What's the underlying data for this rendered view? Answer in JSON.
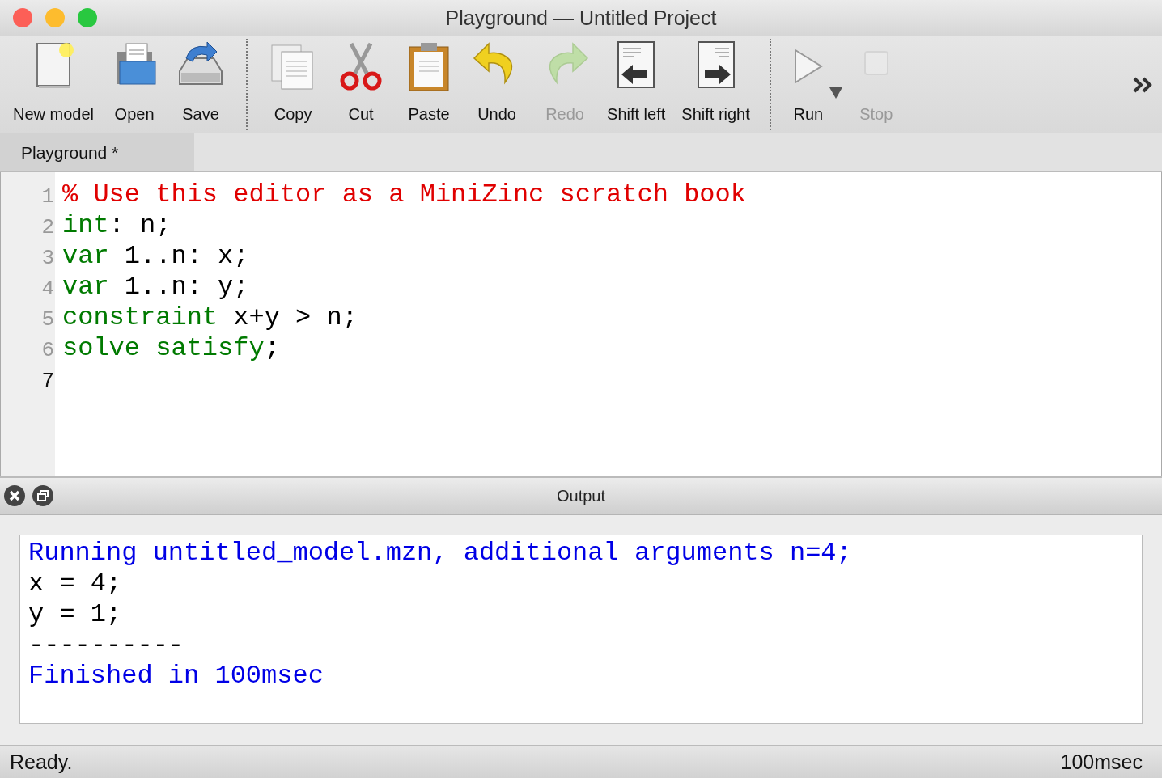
{
  "window": {
    "title": "Playground — Untitled Project"
  },
  "toolbar": {
    "groups": [
      {
        "items": [
          {
            "kind": "new",
            "label": "New model",
            "disabled": false
          },
          {
            "kind": "open",
            "label": "Open",
            "disabled": false
          },
          {
            "kind": "save",
            "label": "Save",
            "disabled": false
          }
        ]
      },
      {
        "items": [
          {
            "kind": "copy",
            "label": "Copy",
            "disabled": false
          },
          {
            "kind": "cut",
            "label": "Cut",
            "disabled": false
          },
          {
            "kind": "paste",
            "label": "Paste",
            "disabled": false
          },
          {
            "kind": "undo",
            "label": "Undo",
            "disabled": false
          },
          {
            "kind": "redo",
            "label": "Redo",
            "disabled": true
          },
          {
            "kind": "shift_left",
            "label": "Shift left",
            "disabled": false
          },
          {
            "kind": "shift_right",
            "label": "Shift right",
            "disabled": false
          }
        ]
      },
      {
        "items": [
          {
            "kind": "run",
            "label": "Run",
            "disabled": false
          },
          {
            "kind": "stop",
            "label": "Stop",
            "disabled": true
          }
        ]
      }
    ]
  },
  "tabs": [
    {
      "label": "Playground *",
      "selected": true
    }
  ],
  "editor": {
    "lines": [
      {
        "number": "1",
        "current": false,
        "tokens": [
          {
            "kind": "comment",
            "text": "% Use this editor as a MiniZinc scratch book"
          }
        ]
      },
      {
        "number": "2",
        "current": false,
        "tokens": [
          {
            "kind": "keyword",
            "text": "int"
          },
          {
            "kind": "plain",
            "text": ": n;"
          }
        ]
      },
      {
        "number": "3",
        "current": false,
        "tokens": [
          {
            "kind": "keyword",
            "text": "var"
          },
          {
            "kind": "plain",
            "text": " 1..n: x;"
          }
        ]
      },
      {
        "number": "4",
        "current": false,
        "tokens": [
          {
            "kind": "keyword",
            "text": "var"
          },
          {
            "kind": "plain",
            "text": " 1..n: y;"
          }
        ]
      },
      {
        "number": "5",
        "current": false,
        "tokens": [
          {
            "kind": "keyword",
            "text": "constraint"
          },
          {
            "kind": "plain",
            "text": " x+y > n;"
          }
        ]
      },
      {
        "number": "6",
        "current": false,
        "tokens": [
          {
            "kind": "keyword",
            "text": "solve satisfy"
          },
          {
            "kind": "plain",
            "text": ";"
          }
        ]
      },
      {
        "number": "7",
        "current": true
      }
    ]
  },
  "output": {
    "title": "Output",
    "lines": [
      {
        "kind": "info",
        "text": "Running untitled_model.mzn, additional arguments n=4;"
      },
      {
        "kind": "plain",
        "text": "x = 4;"
      },
      {
        "kind": "plain",
        "text": "y = 1;"
      },
      {
        "kind": "plain",
        "text": "----------"
      },
      {
        "kind": "info",
        "text": "Finished in 100msec"
      }
    ]
  },
  "status_bar": {
    "message": "Ready.",
    "time": "100msec"
  }
}
